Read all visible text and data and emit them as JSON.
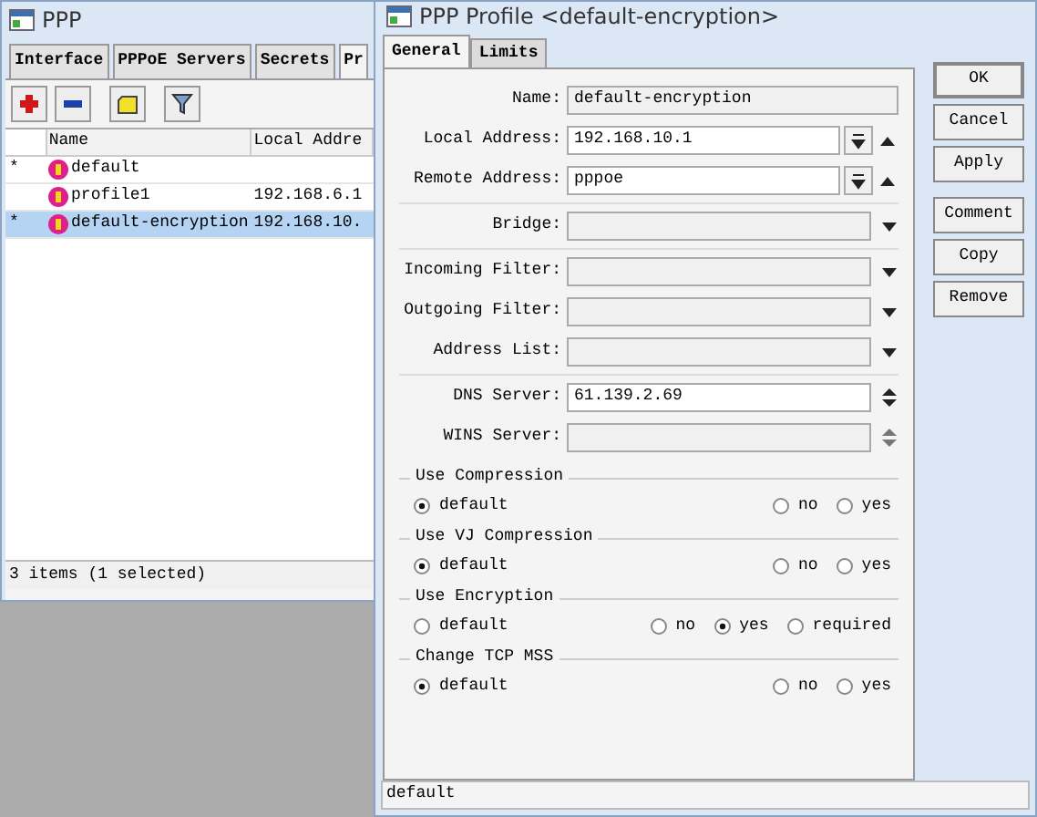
{
  "ppp_window": {
    "title": "PPP",
    "tabs": [
      {
        "label": "Interface",
        "selected": false
      },
      {
        "label": "PPPoE Servers",
        "selected": false
      },
      {
        "label": "Secrets",
        "selected": false
      },
      {
        "label": "Pr",
        "selected": true
      }
    ],
    "table": {
      "columns": [
        "Name",
        "Local Addre"
      ],
      "rows": [
        {
          "flag": "*",
          "name": "default",
          "selected": false
        },
        {
          "name": "profile1",
          "local_address": "192.168.6.1",
          "selected": false
        },
        {
          "flag": "*",
          "name": "default-encryption",
          "local_address": "192.168.10.",
          "selected": true
        }
      ]
    },
    "status_bar": "3 items (1 selected)"
  },
  "profile_window": {
    "title": "PPP Profile <default-encryption>",
    "tabs": [
      {
        "label": "General",
        "selected": true
      },
      {
        "label": "Limits",
        "selected": false
      }
    ],
    "sections": [
      [
        {
          "kind": "text",
          "label": "Name:",
          "value": "default-encryption"
        },
        {
          "kind": "address",
          "label": "Local Address:",
          "value": "192.168.10.1"
        },
        {
          "kind": "address",
          "label": "Remote Address:",
          "value": "pppoe"
        }
      ],
      [
        {
          "kind": "select",
          "label": "Bridge:"
        }
      ],
      [
        {
          "kind": "select",
          "label": "Incoming Filter:"
        },
        {
          "kind": "select",
          "label": "Outgoing Filter:"
        },
        {
          "kind": "select",
          "label": "Address List:"
        }
      ],
      [
        {
          "kind": "servers",
          "label": "DNS Server:",
          "value": "61.139.2.69"
        },
        {
          "kind": "servers",
          "label": "WINS Server:"
        }
      ]
    ],
    "radio_groups": [
      {
        "title": "Use Compression",
        "options": [
          {
            "label": "default",
            "selected": true
          },
          {
            "label": "no",
            "selected": false
          },
          {
            "label": "yes",
            "selected": false
          }
        ]
      },
      {
        "title": "Use VJ Compression",
        "options": [
          {
            "label": "default",
            "selected": true
          },
          {
            "label": "no",
            "selected": false
          },
          {
            "label": "yes",
            "selected": false
          }
        ]
      },
      {
        "title": "Use Encryption",
        "options": [
          {
            "label": "default",
            "selected": false
          },
          {
            "label": "no",
            "selected": false
          },
          {
            "label": "yes",
            "selected": true
          },
          {
            "label": "required",
            "selected": false
          }
        ]
      },
      {
        "title": "Change TCP MSS",
        "options": [
          {
            "label": "default",
            "selected": true
          },
          {
            "label": "no",
            "selected": false
          },
          {
            "label": "yes",
            "selected": false
          }
        ]
      }
    ],
    "buttons": [
      [
        "OK",
        "Cancel",
        "Apply"
      ],
      [
        "Comment",
        "Copy",
        "Remove"
      ]
    ],
    "status_bar": "default"
  }
}
